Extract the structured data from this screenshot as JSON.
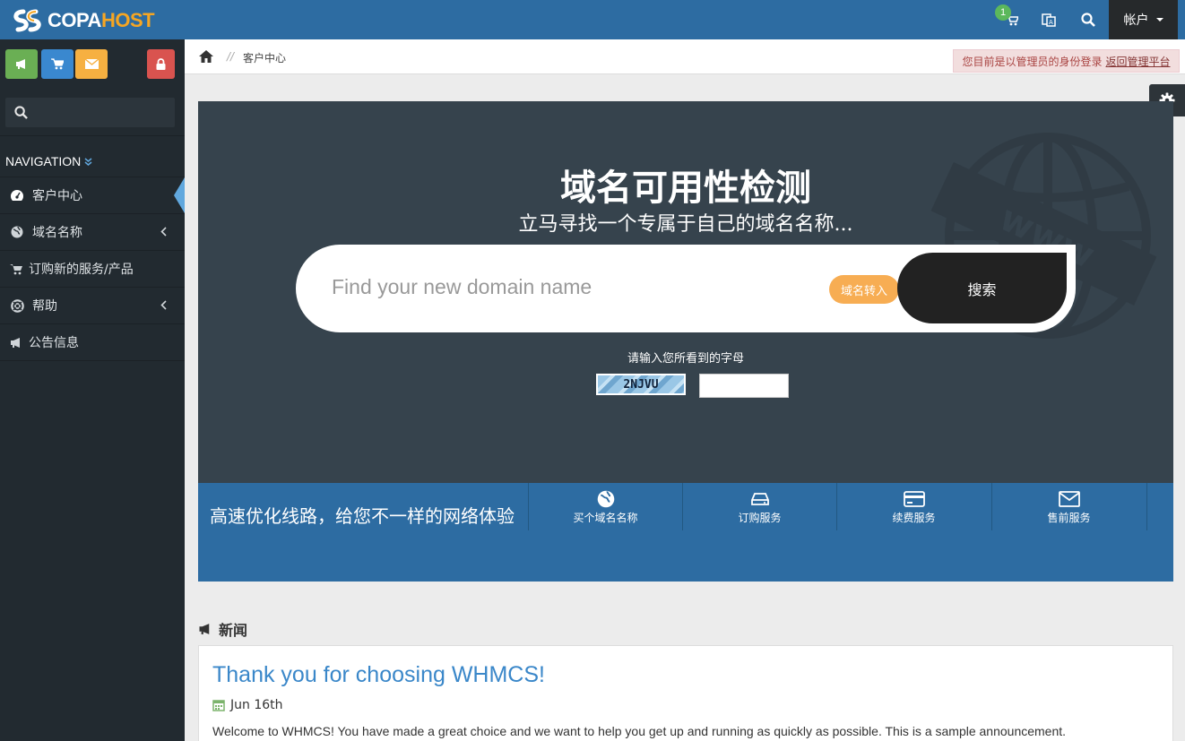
{
  "topbar": {
    "brand_part1": "COPA",
    "brand_part2": "HOST",
    "cart_count": "1",
    "account_label": "帐户",
    "icons": [
      "cart-icon",
      "language-icon",
      "search-icon"
    ]
  },
  "sidebar": {
    "quick_buttons": [
      {
        "name": "announcements-icon",
        "color": "#6aaf54"
      },
      {
        "name": "cart-icon",
        "color": "#3a88cf"
      },
      {
        "name": "mail-icon",
        "color": "#f6b041"
      },
      {
        "name": "lock-icon",
        "color": "#d9534f"
      }
    ],
    "nav_heading": "NAVIGATION",
    "items": [
      {
        "label": "客户中心",
        "icon": "dashboard-icon",
        "active": true
      },
      {
        "label": "域名名称",
        "icon": "globe-icon",
        "has_submenu": true
      },
      {
        "label": "订购新的服务/产品",
        "icon": "cart-icon"
      },
      {
        "label": "帮助",
        "icon": "support-icon",
        "has_submenu": true
      },
      {
        "label": "公告信息",
        "icon": "bullhorn-icon"
      }
    ]
  },
  "breadcrumb": {
    "separator": "//",
    "current": "客户中心"
  },
  "admin_notice": {
    "text": "您目前是以管理员的身份登录",
    "link": "返回管理平台"
  },
  "hero": {
    "title": "域名可用性检测",
    "subtitle": "立马寻找一个专属于自己的域名名称...",
    "search_placeholder": "Find your new domain name",
    "transfer_label": "域名转入",
    "search_label": "搜索",
    "captcha_label": "请输入您所看到的字母",
    "captcha_code": "2NJVU"
  },
  "strip": {
    "tagline": "高速优化线路，给您不一样的网络体验",
    "actions": [
      {
        "label": "买个域名名称",
        "icon": "globe-icon"
      },
      {
        "label": "订购服务",
        "icon": "server-icon"
      },
      {
        "label": "续费服务",
        "icon": "credit-card-icon"
      },
      {
        "label": "售前服务",
        "icon": "envelope-icon"
      }
    ]
  },
  "news": {
    "heading": "新闻",
    "title": "Thank you for choosing WHMCS!",
    "date": "Jun 16th",
    "body": "Welcome to WHMCS! You have made a great choice and we want to help you get up and running as quickly as possible. This is a sample announcement."
  },
  "colors": {
    "topbar": "#2d6ca2",
    "sidebar": "#222a30",
    "hero": "#36434d",
    "accent_orange": "#f7ad53"
  }
}
